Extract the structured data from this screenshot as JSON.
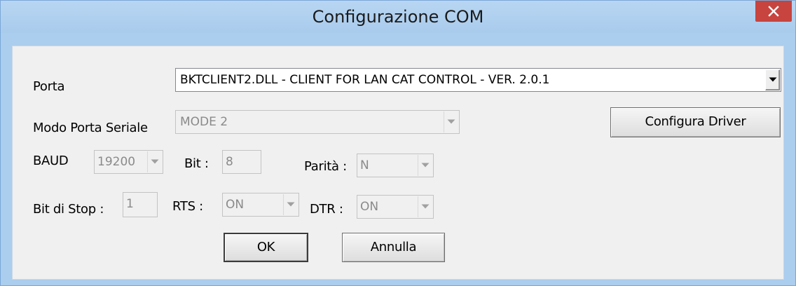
{
  "window": {
    "title": "Configurazione COM",
    "close_icon": "close-icon"
  },
  "form": {
    "porta": {
      "label": "Porta",
      "value": "BKTCLIENT2.DLL - CLIENT FOR LAN CAT CONTROL - VER. 2.0.1"
    },
    "modo_porta": {
      "label": "Modo Porta Seriale",
      "value": "MODE 2"
    },
    "configura_driver_label": "Configura Driver",
    "baud": {
      "label": "BAUD",
      "value": "19200"
    },
    "bit": {
      "label": "Bit :",
      "value": "8"
    },
    "parita": {
      "label": "Parità :",
      "value": "N"
    },
    "bit_stop": {
      "label": "Bit di Stop :",
      "value": "1"
    },
    "rts": {
      "label": "RTS :",
      "value": "ON"
    },
    "dtr": {
      "label": "DTR :",
      "value": "ON"
    }
  },
  "buttons": {
    "ok_label": "OK",
    "cancel_label": "Annulla"
  },
  "colors": {
    "title_bar": "#abcdee",
    "close_button": "#c7443f",
    "client_area": "#f0f0f0"
  }
}
